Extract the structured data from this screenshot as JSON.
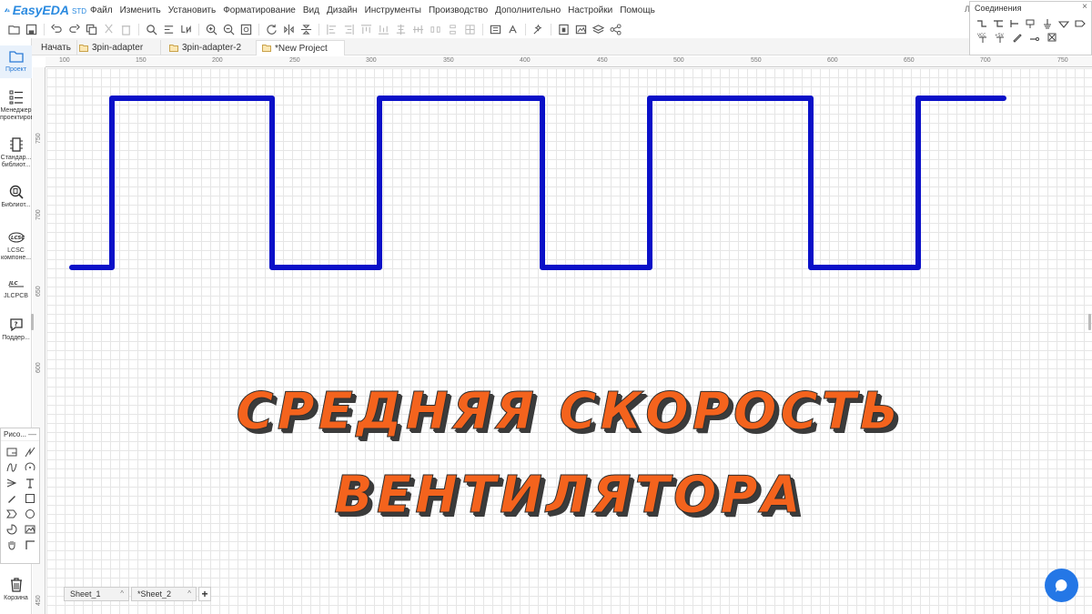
{
  "app": {
    "logo_text": "EasyEDA",
    "logo_suffix": "STD",
    "user_initial": "Ли"
  },
  "menu": [
    "Файл",
    "Изменить",
    "Установить",
    "Форматирование",
    "Вид",
    "Дизайн",
    "Инструменты",
    "Производство",
    "Дополнительно",
    "Настройки",
    "Помощь"
  ],
  "connections_panel": {
    "title": "Соединения",
    "close": "×"
  },
  "sidebar": [
    {
      "label": "Проект",
      "icon": "folder-icon",
      "active": true
    },
    {
      "label": "Менеджер\nпроектиров",
      "icon": "list-manager-icon",
      "active": false
    },
    {
      "label": "Стандар...\nбиблиот...",
      "icon": "chip-icon",
      "active": false
    },
    {
      "label": "Библиот...",
      "icon": "library-search-icon",
      "active": false
    },
    {
      "label": "LCSC\nкомпоне...",
      "icon": "lcsc-logo-icon",
      "active": false
    },
    {
      "label": "JLCPCB",
      "icon": "jlcpcb-logo-icon",
      "active": false
    },
    {
      "label": "Поддер...",
      "icon": "help-icon",
      "active": false
    },
    {
      "label": "Корзина",
      "icon": "trash-icon",
      "active": false
    }
  ],
  "tabs": [
    {
      "label": "Начать",
      "folder": false,
      "active": false
    },
    {
      "label": "3pin-adapter",
      "folder": true,
      "active": false
    },
    {
      "label": "3pin-adapter-2",
      "folder": true,
      "active": false
    },
    {
      "label": "*New Project",
      "folder": true,
      "active": true
    }
  ],
  "ruler_top": [
    "100",
    "150",
    "200",
    "250",
    "300",
    "350",
    "400",
    "450",
    "500",
    "550",
    "600",
    "650",
    "700",
    "750"
  ],
  "ruler_left": [
    "750",
    "700",
    "650",
    "600",
    "450"
  ],
  "overlay": {
    "line1": "СРЕДНЯЯ СКОРОСТЬ",
    "line2": "ВЕНТИЛЯТОРА"
  },
  "draw_panel": {
    "title": "Рисо...",
    "minimize": "—"
  },
  "sheets": [
    {
      "label": "Sheet_1"
    },
    {
      "label": "*Sheet_2"
    }
  ],
  "sheet_add": "+",
  "colors": {
    "wire": "#0a10c8",
    "overlay_text": "#f4631d",
    "accent": "#2a8ae0",
    "chat": "#2477e6"
  }
}
